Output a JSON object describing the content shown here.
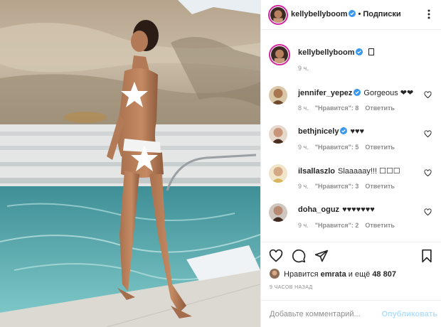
{
  "post": {
    "author": "kellybellyboom",
    "follow_separator": "•",
    "follow_label": "Подписки",
    "caption": "",
    "caption_time": "9 ч."
  },
  "comments": [
    {
      "username": "jennifer_yepez",
      "verified": true,
      "text": "Gorgeous ❤❤",
      "time": "8 ч.",
      "likes": "\"Нравится\": 8",
      "reply": "Ответить"
    },
    {
      "username": "bethjnicely",
      "verified": true,
      "text": "♥♥♥",
      "time": "9 ч.",
      "likes": "\"Нравится\": 5",
      "reply": "Ответить"
    },
    {
      "username": "ilsallaszlo",
      "verified": false,
      "text": "Slaaaaay!!! ☐☐☐",
      "time": "9 ч.",
      "likes": "\"Нравится\": 3",
      "reply": "Ответить"
    },
    {
      "username": "doha_oguz",
      "verified": false,
      "text": "♥♥♥♥♥♥♥",
      "time": "9 ч.",
      "likes": "\"Нравится\": 2",
      "reply": "Ответить"
    }
  ],
  "likes": {
    "prefix": "Нравится",
    "user": "emrata",
    "connector": "и ещё",
    "count": "48 807"
  },
  "posted_ago": "9 ЧАСОВ НАЗАД",
  "comment_input": {
    "placeholder": "Добавьте комментарий...",
    "submit_label": "Опубликовать"
  },
  "colors": {
    "accent": "#0095f6",
    "verified": "#3897f0",
    "submit_disabled": "#b2dffc",
    "muted": "#8e8e8e",
    "border": "#efefef",
    "text": "#262626",
    "pool_water": "#5fb3b8",
    "rock": "#c7b8a3",
    "sky": "#e8eef2"
  },
  "icons": {
    "header": [
      "more-icon"
    ],
    "actions": [
      "heart-icon",
      "comment-icon",
      "share-icon",
      "bookmark-icon"
    ],
    "comment_like": "heart-outline-icon",
    "verified": "verified-badge-icon"
  }
}
